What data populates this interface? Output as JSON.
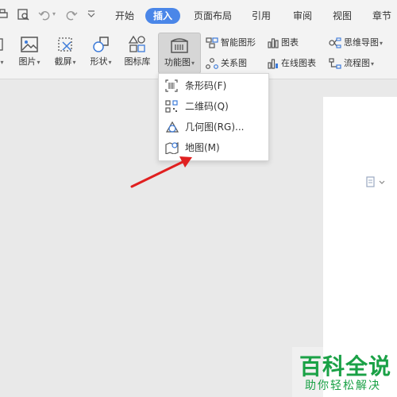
{
  "tabs": [
    {
      "label": "开始",
      "active": false
    },
    {
      "label": "插入",
      "active": true
    },
    {
      "label": "页面布局",
      "active": false
    },
    {
      "label": "引用",
      "active": false
    },
    {
      "label": "审阅",
      "active": false
    },
    {
      "label": "视图",
      "active": false
    },
    {
      "label": "章节",
      "active": false
    }
  ],
  "ribbon": {
    "picture": "图片",
    "screenshot": "截屏",
    "shapes": "形状",
    "icon_library": "图标库",
    "function_chart": "功能图",
    "smart_graphic": "智能图形",
    "chart": "图表",
    "mind_map": "思维导图",
    "relation_chart": "关系图",
    "online_chart": "在线图表",
    "flowchart": "流程图"
  },
  "dropdown_menu": {
    "items": [
      {
        "label": "条形码(F)",
        "icon": "barcode-icon"
      },
      {
        "label": "二维码(Q)",
        "icon": "qrcode-icon"
      },
      {
        "label": "几何图(RG)...",
        "icon": "geometry-icon"
      },
      {
        "label": "地图(M)",
        "icon": "map-icon"
      }
    ]
  },
  "watermark": {
    "title": "百科全说",
    "subtitle": "助你轻松解决"
  },
  "colors": {
    "active_tab": "#4a86e8",
    "arrow": "#e02020",
    "watermark": "#1aa146",
    "icon_blue": "#3d7bd9"
  }
}
